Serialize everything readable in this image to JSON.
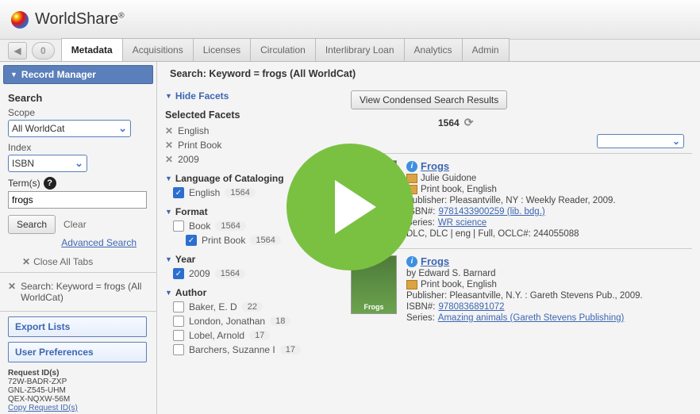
{
  "brand": {
    "name": "WorldShare",
    "reg": "®"
  },
  "nav": {
    "count": "0",
    "tabs": [
      "Metadata",
      "Acquisitions",
      "Licenses",
      "Circulation",
      "Interlibrary Loan",
      "Analytics",
      "Admin"
    ],
    "active": 0
  },
  "sidebar": {
    "panel_title": "Record Manager",
    "search_label": "Search",
    "scope_label": "Scope",
    "scope_value": "All WorldCat",
    "index_label": "Index",
    "index_value": "ISBN",
    "terms_label": "Term(s)",
    "terms_value": "frogs",
    "search_btn": "Search",
    "clear_btn": "Clear",
    "advanced": "Advanced Search",
    "close_tabs": "Close All Tabs",
    "crumb": "Search: Keyword = frogs (All WorldCat)",
    "export_lists": "Export Lists",
    "user_prefs": "User Preferences",
    "req_header": "Request ID(s)",
    "req_ids": [
      "72W-BADR-ZXP",
      "GNL-Z545-UHM",
      "QEX-NQXW-56M"
    ],
    "copy_req": "Copy Request ID(s)"
  },
  "main": {
    "title": "Search: Keyword = frogs (All WorldCat)",
    "hide_facets": "Hide Facets",
    "selected_label": "Selected Facets",
    "selected": [
      "English",
      "Print Book",
      "2009"
    ],
    "groups": [
      {
        "name": "Language of Cataloging",
        "items": [
          {
            "label": "English",
            "count": "1564",
            "checked": true
          }
        ]
      },
      {
        "name": "Format",
        "items": [
          {
            "label": "Book",
            "count": "1564",
            "checked": false
          },
          {
            "label": "Print Book",
            "count": "1564",
            "checked": true,
            "sub": true
          }
        ]
      },
      {
        "name": "Year",
        "items": [
          {
            "label": "2009",
            "count": "1564",
            "checked": true
          }
        ]
      },
      {
        "name": "Author",
        "items": [
          {
            "label": "Baker, E. D",
            "count": "22",
            "checked": false
          },
          {
            "label": "London, Jonathan",
            "count": "18",
            "checked": false
          },
          {
            "label": "Lobel, Arnold",
            "count": "17",
            "checked": false
          },
          {
            "label": "Barchers, Suzanne I",
            "count": "17",
            "checked": false
          }
        ]
      }
    ],
    "condensed_btn": "View Condensed Search Results",
    "result_count": "1564",
    "results": [
      {
        "title": "Frogs",
        "author": "Julie Guidone",
        "format": "Print book, English",
        "publisher": "Publisher: Pleasantville, NY : Weekly Reader, 2009.",
        "isbn_label": "ISBN#:",
        "isbn": "9781433900259 (lib. bdg.)",
        "series_label": "Series:",
        "series": "WR science",
        "meta": "DLC, DLC | eng | Full, OCLC#: 244055088"
      },
      {
        "title": "Frogs",
        "author": "by Edward S. Barnard",
        "format": "Print book, English",
        "publisher": "Publisher: Pleasantville, N.Y. : Gareth Stevens Pub., 2009.",
        "isbn_label": "ISBN#:",
        "isbn": "9780836891072",
        "series_label": "Series:",
        "series": "Amazing animals (Gareth Stevens Publishing)"
      }
    ]
  }
}
